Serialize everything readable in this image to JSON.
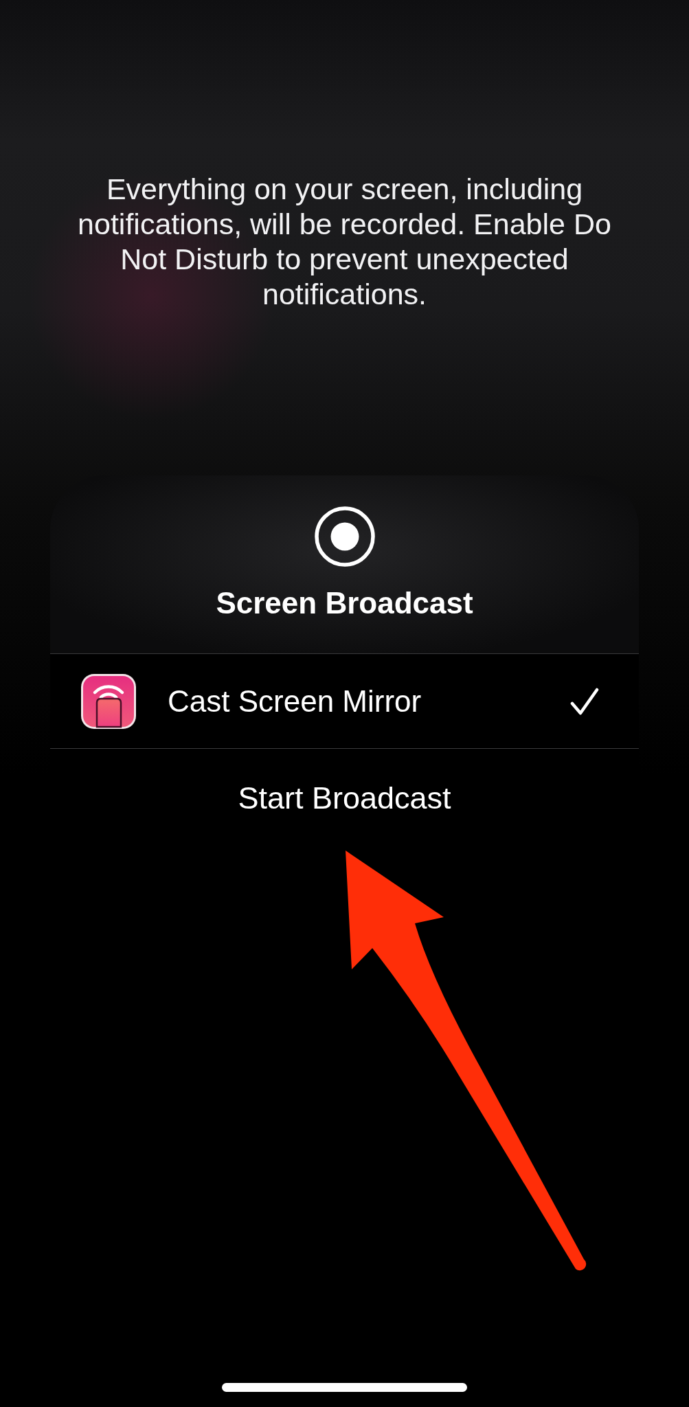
{
  "message": "Everything on your screen, including notifications, will be recorded. Enable Do Not Disturb to prevent unexpected notifications.",
  "sheet": {
    "title": "Screen Broadcast",
    "apps": [
      {
        "name": "Cast Screen Mirror",
        "selected": true
      }
    ],
    "action": "Start Broadcast"
  }
}
